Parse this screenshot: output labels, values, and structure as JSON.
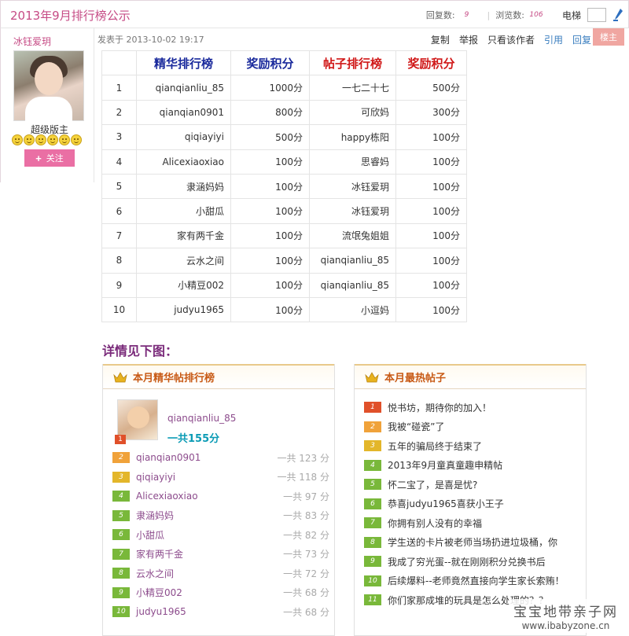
{
  "header": {
    "title": "2013年9月排行榜公示",
    "replies_label": "回复数:",
    "replies_value": "9",
    "views_label": "浏览数:",
    "views_value": "106",
    "elevator_label": "电梯"
  },
  "author": {
    "name": "冰钰爱玥",
    "rank": "超级版主",
    "follow_label": "关注"
  },
  "post": {
    "meta": "发表于 2013-10-02 19:17",
    "actions": [
      "复制",
      "举报",
      "只看该作者",
      "引用",
      "回复"
    ],
    "floor_label": "楼主"
  },
  "ranking_table": {
    "headers": [
      "精华排行榜",
      "奖励积分",
      "帖子排行榜",
      "奖励积分"
    ],
    "rows": [
      [
        "1",
        "qianqianliu_85",
        "1000分",
        "一七二十七",
        "500分"
      ],
      [
        "2",
        "qianqian0901",
        "800分",
        "可欣妈",
        "300分"
      ],
      [
        "3",
        "qiqiayiyi",
        "500分",
        "happy栋阳",
        "100分"
      ],
      [
        "4",
        "Alicexiaoxiao",
        "100分",
        "思睿妈",
        "100分"
      ],
      [
        "5",
        "隶涵妈妈",
        "100分",
        "冰钰爱玥",
        "100分"
      ],
      [
        "6",
        "小甜瓜",
        "100分",
        "冰钰爱玥",
        "100分"
      ],
      [
        "7",
        "家有两千金",
        "100分",
        "流氓兔姐姐",
        "100分"
      ],
      [
        "8",
        "云水之间",
        "100分",
        "qianqianliu_85",
        "100分"
      ],
      [
        "9",
        "小精豆002",
        "100分",
        "qianqianliu_85",
        "100分"
      ],
      [
        "10",
        "judyu1965",
        "100分",
        "小逗妈",
        "100分"
      ]
    ]
  },
  "details_heading": "详情见下图：",
  "left_panel": {
    "title": "本月精华帖排行榜",
    "top_user": {
      "rank": "1",
      "name": "qianqianliu_85",
      "score": "一共155分"
    },
    "items": [
      {
        "rank": "2",
        "name": "qianqian0901",
        "score": "一共 123 分"
      },
      {
        "rank": "3",
        "name": "qiqiayiyi",
        "score": "一共 118 分"
      },
      {
        "rank": "4",
        "name": "Alicexiaoxiao",
        "score": "一共 97 分"
      },
      {
        "rank": "5",
        "name": "隶涵妈妈",
        "score": "一共 83 分"
      },
      {
        "rank": "6",
        "name": "小甜瓜",
        "score": "一共 82 分"
      },
      {
        "rank": "7",
        "name": "家有两千金",
        "score": "一共 73 分"
      },
      {
        "rank": "8",
        "name": "云水之间",
        "score": "一共 72 分"
      },
      {
        "rank": "9",
        "name": "小精豆002",
        "score": "一共 68 分"
      },
      {
        "rank": "10",
        "name": "judyu1965",
        "score": "一共 68 分"
      }
    ]
  },
  "right_panel": {
    "title": "本月最热帖子",
    "items": [
      {
        "rank": "1",
        "text": "悦书坊，期待你的加入！"
      },
      {
        "rank": "2",
        "text": "我被“碰瓷”了"
      },
      {
        "rank": "3",
        "text": "五年的骗局终于结束了"
      },
      {
        "rank": "4",
        "text": "2013年9月童真童趣申精帖"
      },
      {
        "rank": "5",
        "text": "怀二宝了，是喜是忧?"
      },
      {
        "rank": "6",
        "text": "恭喜judyu1965喜获小王子"
      },
      {
        "rank": "7",
        "text": "你拥有别人没有的幸福"
      },
      {
        "rank": "8",
        "text": "学生送的卡片被老师当场扔进垃圾桶，你"
      },
      {
        "rank": "9",
        "text": "我成了穷光蛋--就在刚刚积分兑换书后"
      },
      {
        "rank": "10",
        "text": "后续爆料--老师竟然直接向学生家长索贿！"
      },
      {
        "rank": "11",
        "text": "你们家那成堆的玩具是怎么处理的？？"
      }
    ]
  },
  "watermark": {
    "line1": "宝宝地带亲子网",
    "line2": "www.ibabyzone.cn"
  },
  "colors": {
    "accent_pink": "#c64b85",
    "follow_button": "#ea6fa4",
    "header_blue": "#1a2a9c",
    "header_red": "#d01818"
  }
}
